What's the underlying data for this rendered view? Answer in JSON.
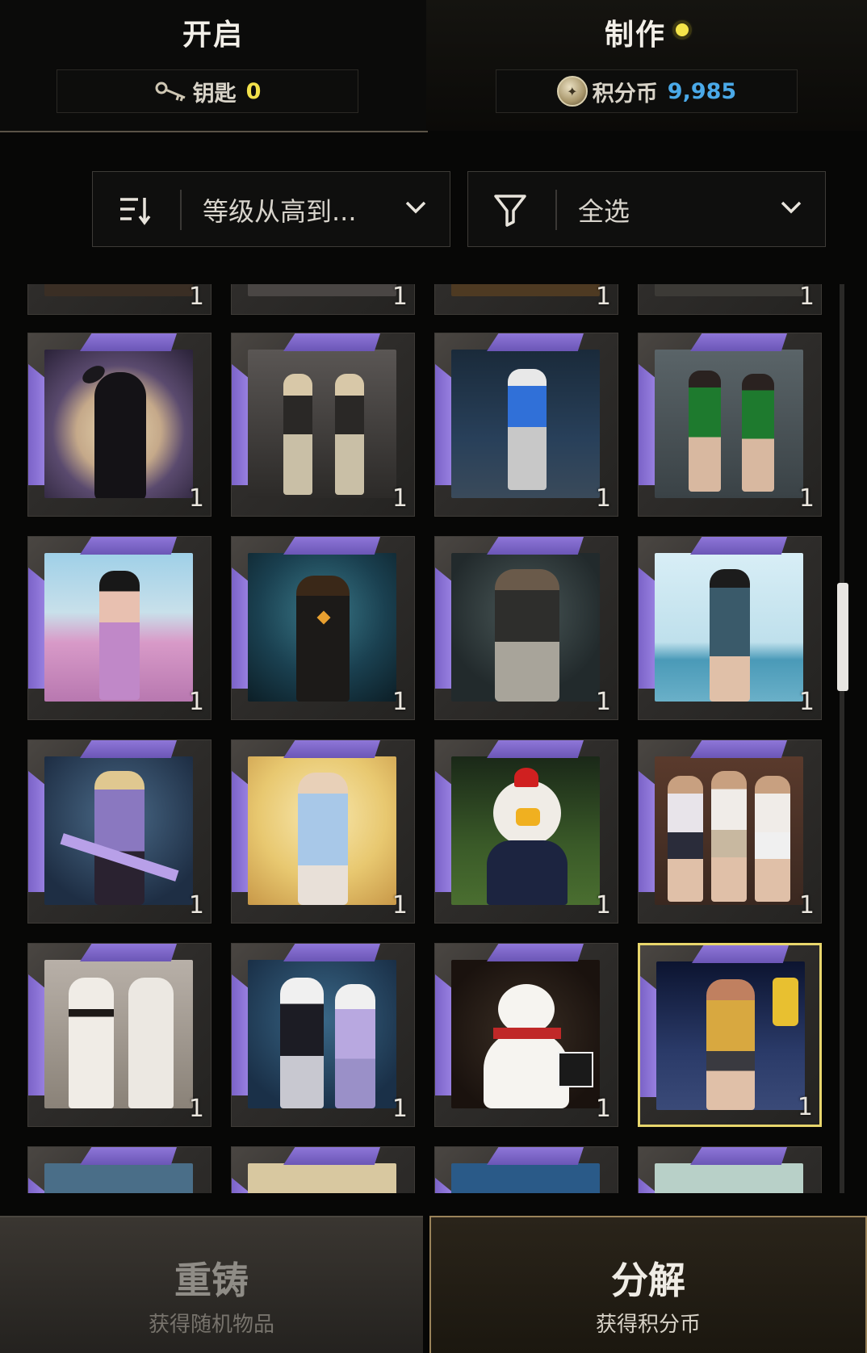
{
  "tabs": {
    "open": {
      "label": "开启",
      "currency_label": "钥匙",
      "currency_value": "0",
      "currency_icon": "key-icon"
    },
    "craft": {
      "label": "制作",
      "currency_label": "积分币",
      "currency_value": "9,985",
      "currency_icon": "coin-icon"
    }
  },
  "sort": {
    "label": "等级从高到...",
    "icon": "sort-icon"
  },
  "filter": {
    "label": "全选",
    "icon": "filter-icon"
  },
  "grid": {
    "items": [
      {
        "name": "bunny-hood-outfit",
        "count": "1"
      },
      {
        "name": "camo-duo-outfit",
        "count": "1"
      },
      {
        "name": "blue-puffer-outfit",
        "count": "1"
      },
      {
        "name": "green-jacket-outfit",
        "count": "1"
      },
      {
        "name": "pink-street-outfit",
        "count": "1"
      },
      {
        "name": "forest-figure-outfit",
        "count": "1"
      },
      {
        "name": "tactical-soldier-outfit",
        "count": "1"
      },
      {
        "name": "beach-cheongsam-outfit",
        "count": "1"
      },
      {
        "name": "lavender-dress-outfit",
        "count": "1"
      },
      {
        "name": "bear-ears-outfit",
        "count": "1"
      },
      {
        "name": "chicken-mascot-outfit",
        "count": "1"
      },
      {
        "name": "skirt-trio-outfit",
        "count": "1"
      },
      {
        "name": "white-hoodie-outfit",
        "count": "1"
      },
      {
        "name": "panda-mask-outfit",
        "count": "1"
      },
      {
        "name": "snowman-outfit",
        "count": "1"
      },
      {
        "name": "carnival-jacket-outfit",
        "count": "1"
      }
    ],
    "top_partial_counts": [
      "1",
      "1",
      "1",
      "1"
    ]
  },
  "buttons": {
    "reforge": {
      "title": "重铸",
      "subtitle": "获得随机物品"
    },
    "salvage": {
      "title": "分解",
      "subtitle": "获得积分币"
    }
  },
  "colors": {
    "accent_gold": "#e8d66c",
    "key_yellow": "#f2e14b",
    "coin_blue": "#4aa9e8",
    "rarity_purple": "#8e76d8"
  }
}
